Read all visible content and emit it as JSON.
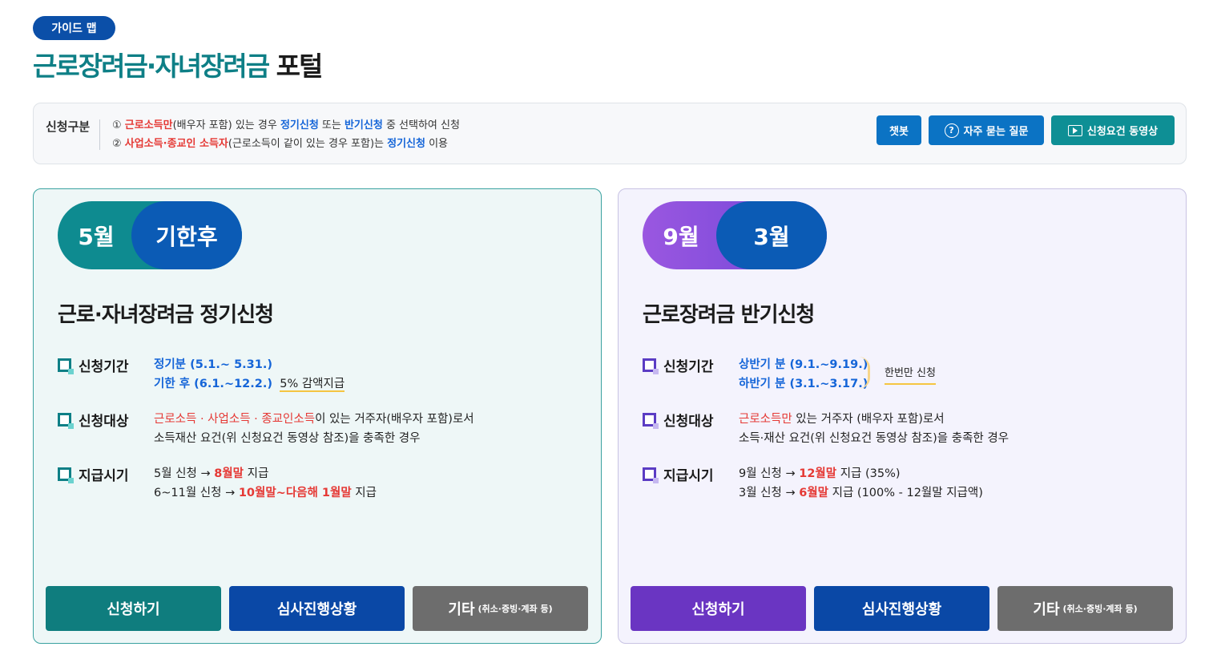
{
  "header": {
    "badge": "가이드 맵",
    "title_accent": "근로장려금·자녀장려금",
    "title_rest": "포털"
  },
  "info": {
    "label": "신청구분",
    "line1": {
      "prefix": "① ",
      "red": "근로소득만",
      "text1": "(배우자 포함) 있는 경우 ",
      "blue1": "정기신청",
      "text2": " 또는 ",
      "blue2": "반기신청",
      "text3": " 중 선택하여 신청"
    },
    "line2": {
      "prefix": "② ",
      "red": "사업소득·종교인 소득자",
      "text1": "(근로소득이 같이 있는 경우 포함)는 ",
      "blue": "정기신청",
      "text2": " 이용"
    },
    "buttons": {
      "chatbot": "챗봇",
      "faq": "자주 묻는 질문",
      "video": "신청요건 동영상"
    }
  },
  "cards": [
    {
      "pill_left": "5월",
      "pill_right": "기한후",
      "title": "근로·자녀장려금 정기신청",
      "period_label": "신청기간",
      "period_line1": "정기분 (5.1.~ 5.31.)",
      "period_line2": "기한 후 (6.1.~12.2.)",
      "period_note": "5% 감액지급",
      "target_label": "신청대상",
      "target_red": "근로소득 · 사업소득 · 종교인소득",
      "target_text1": "이 있는 거주자(배우자 포함)로서",
      "target_line2": "소득재산 요건(위 신청요건 동영상 참조)을 충족한 경우",
      "pay_label": "지급시기",
      "pay_line1_a": "5월 신청 → ",
      "pay_line1_red": "8월말",
      "pay_line1_b": " 지급",
      "pay_line2_a": "6~11월 신청 → ",
      "pay_line2_red": "10월말~다음해 1월말",
      "pay_line2_b": " 지급",
      "btn_apply": "신청하기",
      "btn_status": "심사진행상황",
      "btn_etc": "기타",
      "btn_etc_small": "(취소·증빙·계좌 등)"
    },
    {
      "pill_left": "9월",
      "pill_right": "3월",
      "title": "근로장려금 반기신청",
      "period_label": "신청기간",
      "period_line1": "상반기 분 (9.1.~9.19.)",
      "period_line2": "하반기 분 (3.1.~3.17.)",
      "period_note": "한번만 신청",
      "target_label": "신청대상",
      "target_red": "근로소득만",
      "target_text1": " 있는 거주자 (배우자 포함)로서",
      "target_line2": "소득·재산 요건(위 신청요건 동영상 참조)을 충족한 경우",
      "pay_label": "지급시기",
      "pay_line1_a": "9월 신청 → ",
      "pay_line1_red": "12월말",
      "pay_line1_b": " 지급 (35%)",
      "pay_line2_a": "3월 신청 → ",
      "pay_line2_red": "6월말",
      "pay_line2_b": " 지급 (100% - 12월말 지급액)",
      "btn_apply": "신청하기",
      "btn_status": "심사진행상황",
      "btn_etc": "기타",
      "btn_etc_small": "(취소·증빙·계좌 등)"
    }
  ]
}
